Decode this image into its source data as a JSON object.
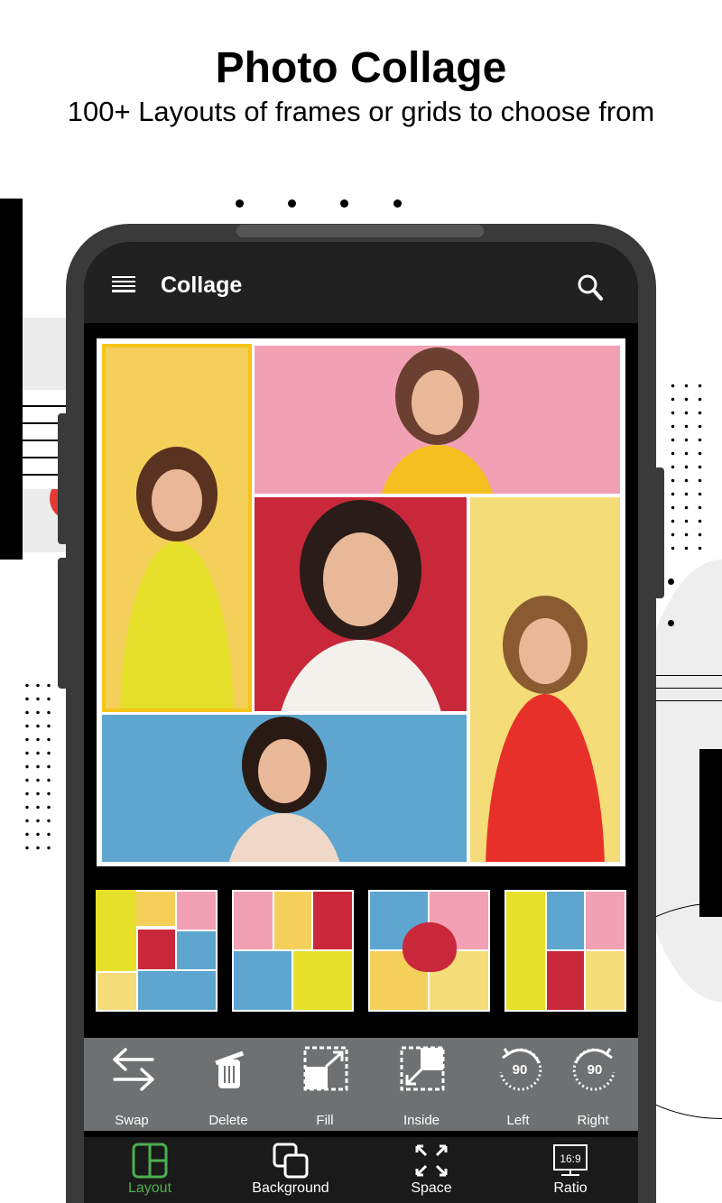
{
  "promo": {
    "title": "Photo Collage",
    "subtitle": "100+ Layouts of frames or grids to choose from"
  },
  "app": {
    "title": "Collage",
    "menu_icon": "hamburger-icon",
    "search_icon": "search-icon"
  },
  "collage": {
    "selected_border_color": "#f5c518",
    "cells": [
      {
        "bg": "#f4d05a",
        "hair": "#5a3320",
        "shirt": "#e6e02a"
      },
      {
        "bg": "#f2a0b4",
        "hair": "#6b4030",
        "shirt": "#f4c020"
      },
      {
        "bg": "#c8283a",
        "hair": "#2a1c18",
        "shirt": "#f4f0ec"
      },
      {
        "bg": "#f4dc78",
        "hair": "#8a5a30",
        "shirt": "#e8302a"
      },
      {
        "bg": "#5ea6d0",
        "hair": "#2a1a14",
        "shirt": "#f0d8c8"
      }
    ]
  },
  "tools": [
    {
      "label": "Swap",
      "icon": "swap-icon"
    },
    {
      "label": "Delete",
      "icon": "trash-icon"
    },
    {
      "label": "Fill",
      "icon": "fill-icon"
    },
    {
      "label": "Inside",
      "icon": "inside-icon"
    },
    {
      "label": "Left",
      "icon": "rotate-left-icon",
      "value": "90"
    },
    {
      "label": "Right",
      "icon": "rotate-right-icon",
      "value": "90"
    }
  ],
  "nav": [
    {
      "label": "Layout",
      "icon": "layout-icon",
      "active": true
    },
    {
      "label": "Background",
      "icon": "background-icon"
    },
    {
      "label": "Space",
      "icon": "space-icon"
    },
    {
      "label": "Ratio",
      "icon": "ratio-icon",
      "value": "16:9"
    }
  ],
  "colors": {
    "accent": "#4caf50",
    "toolbar": "#6e7071",
    "appbar": "#212121"
  }
}
